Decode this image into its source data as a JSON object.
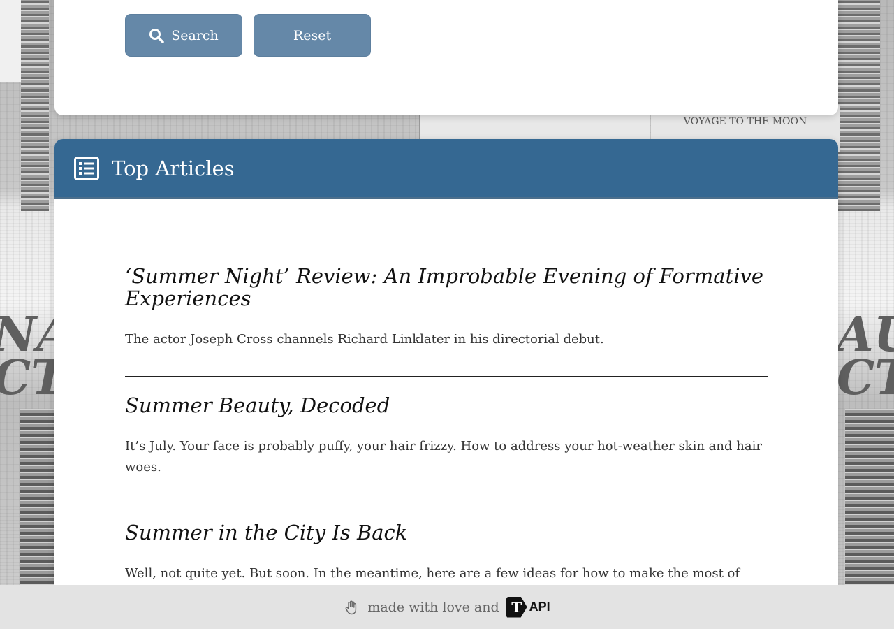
{
  "search_form": {
    "search_label": "Search",
    "reset_label": "Reset"
  },
  "background": {
    "voyage_text": "VOYAGE TO THE MOON"
  },
  "top_articles": {
    "title": "Top Articles",
    "items": [
      {
        "headline": "‘Summer Night’ Review: An Improbable Evening of Formative Experiences",
        "summary": "The actor Joseph Cross channels Richard Linklater in his directorial debut."
      },
      {
        "headline": "Summer Beauty, Decoded",
        "summary": "It’s July. Your face is probably puffy, your hair frizzy. How to address your hot-weather skin and hair woes."
      },
      {
        "headline": "Summer in the City Is Back",
        "summary": "Well, not quite yet. But soon. In the meantime, here are a few ideas for how to make the most of"
      }
    ]
  },
  "footer": {
    "text": "made with love and",
    "api_label": "API",
    "logo_letter": "T"
  }
}
